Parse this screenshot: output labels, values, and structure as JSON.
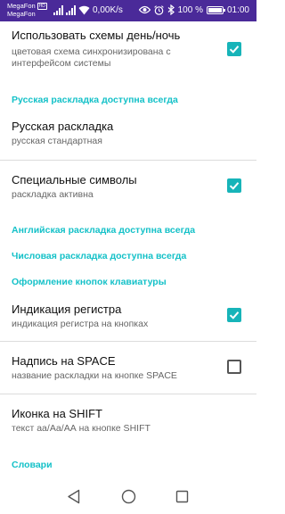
{
  "status_bar": {
    "carrier_1": "MegaFon",
    "carrier_1_badge": "HD",
    "carrier_2": "MegaFon",
    "network_speed": "0,00K/s",
    "battery_level": "100 %",
    "battery_fraction": 1.0,
    "time": "01:00",
    "icons": [
      "signal-icon",
      "signal-icon",
      "wifi-icon",
      "eye-icon",
      "alarm-icon",
      "bluetooth-icon",
      "battery-icon"
    ]
  },
  "settings": {
    "day_night": {
      "title": "Использовать схемы день/ночь",
      "summary_line1": "цветовая схема синхронизирована с",
      "summary_line2": "интерфейсом системы",
      "checked": true
    },
    "category_russian": "Русская раскладка доступна всегда",
    "russian_layout": {
      "title": "Русская раскладка",
      "summary": "русская стандартная"
    },
    "special_symbols": {
      "title": "Специальные символы",
      "summary": "раскладка активна",
      "checked": true
    },
    "category_english": "Английская раскладка доступна всегда",
    "category_numeric": "Числовая раскладка доступна всегда",
    "category_keys_design": "Оформление кнопок клавиатуры",
    "register_indication": {
      "title": "Индикация регистра",
      "summary": "индикация регистра на кнопках",
      "checked": true
    },
    "space_label": {
      "title": "Надпись на SPACE",
      "summary": "название раскладки на кнопке SPACE",
      "checked": false
    },
    "shift_icon": {
      "title": "Иконка на SHIFT",
      "summary": "текст аа/Аа/АА на кнопке SHIFT"
    },
    "category_dictionaries": "Словари"
  },
  "colors": {
    "status_bar": "#4a2a99",
    "accent": "#14c1c8",
    "checkbox_on": "#17b4b9",
    "divider": "#dcdcdc"
  },
  "nav_bar": {
    "icons": [
      "back-icon",
      "home-icon",
      "recents-icon"
    ]
  }
}
